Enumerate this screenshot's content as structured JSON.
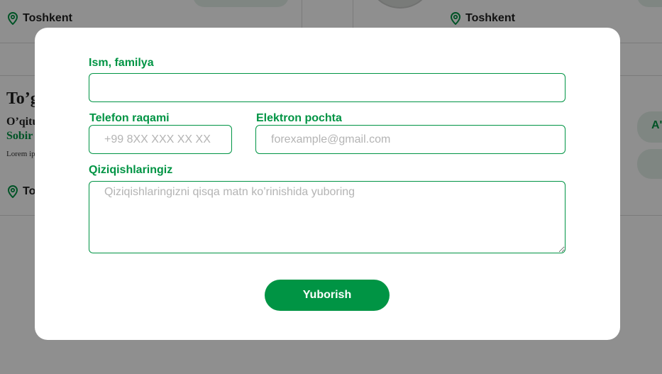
{
  "background": {
    "cards": [
      {
        "location": "Toshkent"
      },
      {
        "location": "Toshkent"
      }
    ],
    "course": {
      "title": "To’g",
      "teacher_label": "O’qitu",
      "teacher_name": "Sobir",
      "description": "Lorem ip adipiscir",
      "location": "To",
      "right_pill_text": "A'"
    }
  },
  "form": {
    "name_label": "Ism, familya",
    "name_value": "",
    "phone_label": "Telefon raqami",
    "phone_placeholder": "+99 8XX XXX XX XX",
    "email_label": "Elektron pochta",
    "email_placeholder": "forexample@gmail.com",
    "interests_label": "Qiziqishlaringiz",
    "interests_placeholder": "Qiziqishlaringizni qisqa matn ko’rinishida yuboring",
    "submit_label": "Yuborish"
  },
  "colors": {
    "accent": "#009444",
    "overlay": "rgba(0,0,0,0.44)"
  },
  "icons": {
    "location": "map-pin-icon"
  }
}
